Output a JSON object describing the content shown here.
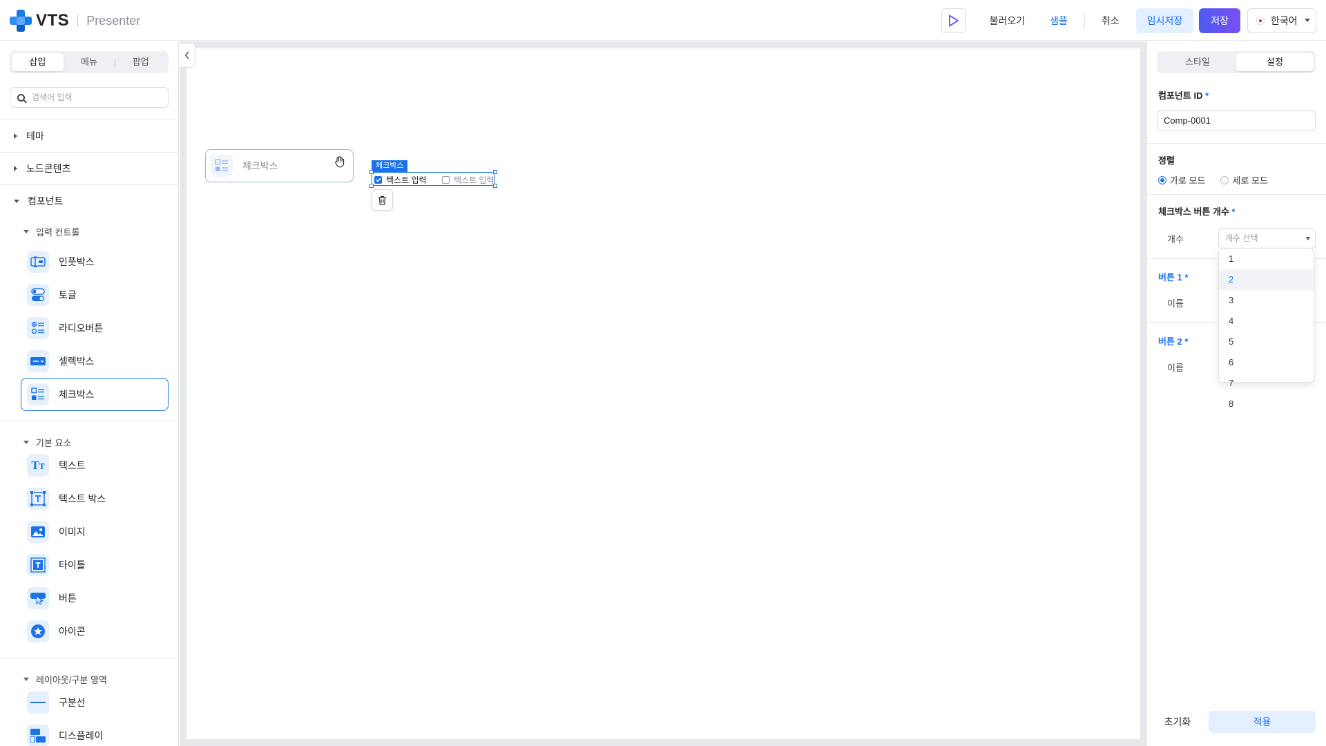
{
  "header": {
    "logo_text": "VTS",
    "app_name": "Presenter",
    "load_label": "불러오기",
    "sample_label": "샘플",
    "cancel_label": "취소",
    "temp_save_label": "임시저장",
    "save_label": "저장",
    "language": "한국어"
  },
  "sidebar": {
    "tabs": [
      "삽입",
      "메뉴",
      "팝업"
    ],
    "search_placeholder": "검색어 입력",
    "theme": "테마",
    "node_content": "노드콘텐츠",
    "components": "컴포넌트",
    "input_controls": {
      "title": "입력 컨트롤",
      "items": [
        "인풋박스",
        "토글",
        "라디오버튼",
        "셀렉박스",
        "체크박스"
      ]
    },
    "basic_elements": {
      "title": "기본 요소",
      "items": [
        "텍스트",
        "텍스트 박스",
        "이미지",
        "타이틀",
        "버튼",
        "아이콘"
      ]
    },
    "layout_section": {
      "title": "레이아웃/구분 영역",
      "items": [
        "구분선",
        "디스플레이"
      ]
    }
  },
  "canvas": {
    "drag_ghost_label": "체크박스",
    "selection_tag": "체크박스",
    "checkbox_1": "텍스트 입력",
    "checkbox_2": "텍스트 입력"
  },
  "panel": {
    "tabs": [
      "스타일",
      "설정"
    ],
    "component_id_label": "컴포넌트 ID",
    "component_id_value": "Comp-0001",
    "align_label": "정렬",
    "align_horizontal": "가로 모드",
    "align_vertical": "세로 모드",
    "count_section_label": "체크박스 버튼 개수",
    "count_label": "개수",
    "count_placeholder": "개수 선택",
    "count_options": [
      "1",
      "2",
      "3",
      "4",
      "5",
      "6",
      "7",
      "8"
    ],
    "button1_label": "버튼 1",
    "button2_label": "버튼 2",
    "name_label": "이름",
    "required_mark": "*",
    "reset_label": "초기화",
    "apply_label": "적용"
  },
  "colors": {
    "accent": "#1a73e8",
    "save_gradient_start": "#4b5cf0",
    "save_gradient_end": "#7b4ff0",
    "light_accent_bg": "#e4efff"
  }
}
